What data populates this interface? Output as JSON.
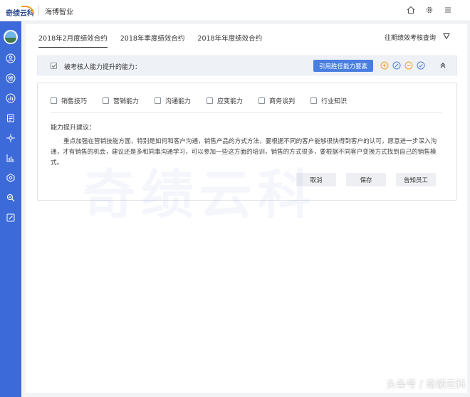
{
  "header": {
    "logo_text": "奇绩云科",
    "company": "海博智业",
    "icons": [
      "home-icon",
      "settings-icon",
      "menu-icon"
    ]
  },
  "sidebar": {
    "items": [
      "user-icon",
      "team-icon",
      "report-icon",
      "goal-icon",
      "org-icon",
      "chart-icon",
      "badge-icon",
      "analysis-icon",
      "edit-icon"
    ]
  },
  "tabs": [
    {
      "label": "2018年2月度绩效合约",
      "active": true
    },
    {
      "label": "2018年季度绩效合约",
      "active": false
    },
    {
      "label": "2018年年度绩效合约",
      "active": false
    }
  ],
  "history_label": "往期绩效考核查询",
  "section": {
    "title": "被考核人能力提升的能力：",
    "cite_button": "引用胜任能力要素"
  },
  "options": [
    "销售技巧",
    "营销能力",
    "沟通能力",
    "应变能力",
    "商务谈判",
    "行业知识"
  ],
  "advice": {
    "title": "能力提升建议：",
    "text": "重点加强在营销技能方面，特别是如何和客户沟通，销售产品的方式方法，要根据不同的客户能够很快得到客户的认可，愿意进一步深入沟通，才有销售的机会，建议还是多和同事沟通学习，可以参加一些这方面的培训，销售的方式很多，要根据不同客户变换方式找到自己的销售模式。"
  },
  "buttons": {
    "cancel": "取消",
    "save": "保存",
    "notify": "告知员工"
  },
  "watermark": "奇绩云科",
  "credit": "头条号 / 奇绩云科",
  "colors": {
    "accent": "#3d6ad9",
    "button": "#4a7fe0",
    "icon_orange": "#f0a020"
  }
}
